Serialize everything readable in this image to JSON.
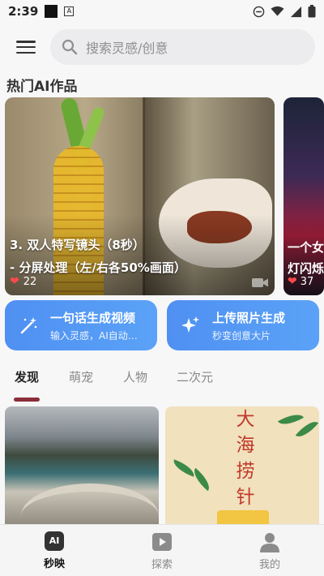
{
  "status_bar": {
    "time": "2:39",
    "notification_letter": "A"
  },
  "search": {
    "placeholder": "搜索灵感/创意"
  },
  "section_title": "热门AI作品",
  "featured_cards": [
    {
      "title": "3. 双人特写镜头（8秒）\n- 分屏处理（左/右各50%画面）",
      "likes": "22",
      "media_icon": "video-camera-icon"
    },
    {
      "title": "一个女\n灯闪烁",
      "likes": "37"
    }
  ],
  "actions": [
    {
      "title": "一句话生成视频",
      "subtitle": "输入灵感，AI自动生成",
      "icon": "magic-wand-icon"
    },
    {
      "title": "上传照片生成",
      "subtitle": "秒变创意大片",
      "icon": "sparkle-icon"
    }
  ],
  "tabs": [
    {
      "label": "发现",
      "active": true
    },
    {
      "label": "萌宠",
      "active": false
    },
    {
      "label": "人物",
      "active": false
    },
    {
      "label": "二次元",
      "active": false
    }
  ],
  "grid": [
    {
      "type": "image"
    },
    {
      "poster_text": "大海捞针"
    }
  ],
  "bottom_nav": [
    {
      "label": "秒映",
      "icon_text": "AI",
      "active": true
    },
    {
      "label": "探索",
      "icon": "play-icon",
      "active": false
    },
    {
      "label": "我的",
      "icon": "person-icon",
      "active": false
    }
  ],
  "colors": {
    "accent_blue": "#4f90f2",
    "tab_underline": "#8a2e3a",
    "heart": "#ff4a4a"
  }
}
